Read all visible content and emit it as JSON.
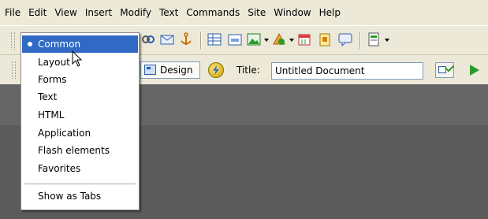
{
  "menubar": {
    "items": [
      "File",
      "Edit",
      "View",
      "Insert",
      "Modify",
      "Text",
      "Commands",
      "Site",
      "Window",
      "Help"
    ]
  },
  "insert_toolbar": {
    "icons": [
      "anchor-link-icon",
      "email-link-icon",
      "named-anchor-icon",
      "table-icon",
      "layer-icon",
      "image-icon",
      "media-icon",
      "date-icon",
      "server-include-icon",
      "comment-icon",
      "template-icon"
    ]
  },
  "popup_menu": {
    "items": [
      "Common",
      "Layout",
      "Forms",
      "Text",
      "HTML",
      "Application",
      "Flash elements",
      "Favorites"
    ],
    "selected": "Common",
    "footer": "Show as Tabs"
  },
  "document_toolbar": {
    "design_label": "Design",
    "title_label": "Title:",
    "title_value": "Untitled Document"
  },
  "colors": {
    "chrome": "#ece9d8",
    "selection": "#316ac5",
    "canvas": "#5b5b5b"
  }
}
